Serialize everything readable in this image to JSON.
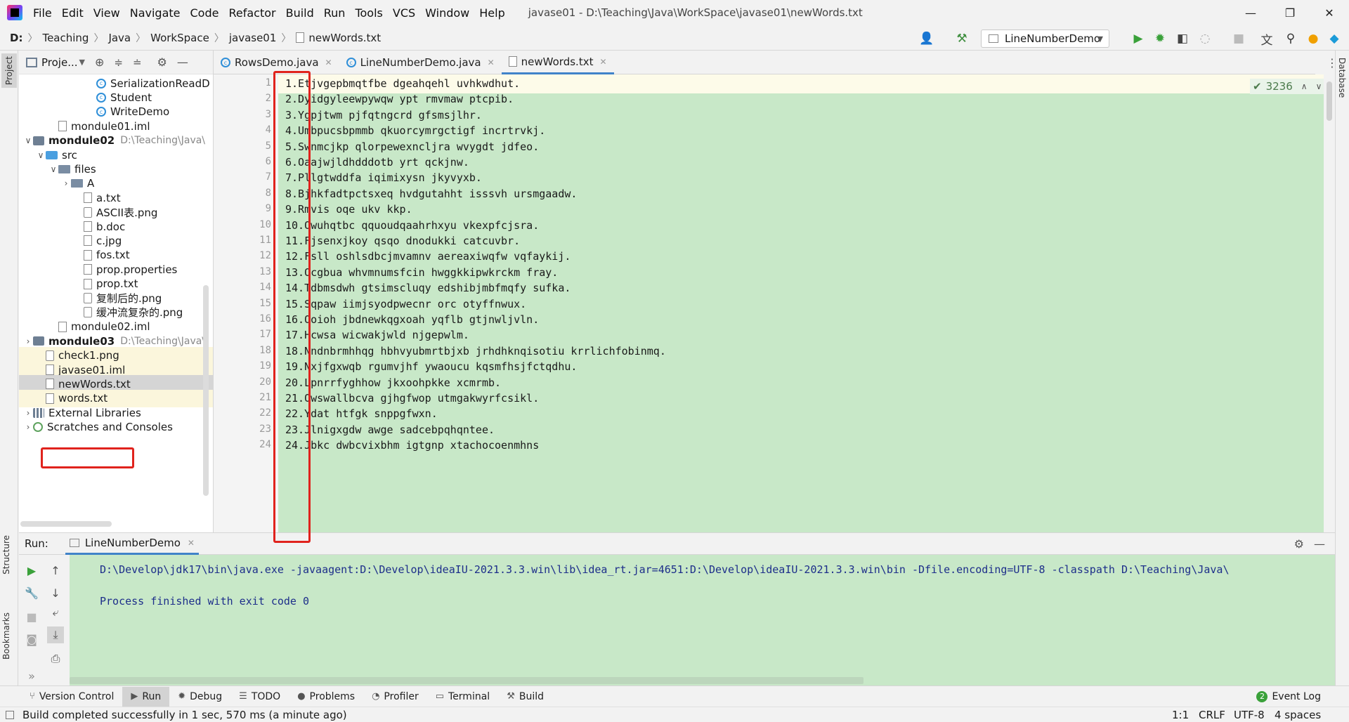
{
  "window": {
    "title": "javase01 - D:\\Teaching\\Java\\WorkSpace\\javase01\\newWords.txt",
    "minimize": "—",
    "maximize": "❐",
    "close": "✕"
  },
  "menu": [
    "File",
    "Edit",
    "View",
    "Navigate",
    "Code",
    "Refactor",
    "Build",
    "Run",
    "Tools",
    "VCS",
    "Window",
    "Help"
  ],
  "breadcrumb": [
    "D:",
    "Teaching",
    "Java",
    "WorkSpace",
    "javase01",
    "newWords.txt"
  ],
  "toolbar": {
    "run_config": "LineNumberDemo"
  },
  "left_strip": {
    "project": "Project",
    "structure": "Structure",
    "bookmarks": "Bookmarks"
  },
  "right_strip": {
    "database": "Database"
  },
  "project_panel": {
    "title": "Proje...",
    "items": [
      {
        "label": "SerializationReadD",
        "icon": "java-class-icon",
        "indent": 5,
        "arrow": ""
      },
      {
        "label": "Student",
        "icon": "java-class-icon",
        "indent": 5,
        "arrow": ""
      },
      {
        "label": "WriteDemo",
        "icon": "java-class-icon",
        "indent": 5,
        "arrow": ""
      },
      {
        "label": "mondule01.iml",
        "icon": "iml-file-icon",
        "indent": 2,
        "arrow": ""
      },
      {
        "label": "mondule02",
        "icon": "module-icon",
        "indent": 0,
        "arrow": "∨",
        "bold": true,
        "hint": "D:\\Teaching\\Java\\"
      },
      {
        "label": "src",
        "icon": "source-folder-icon",
        "indent": 1,
        "arrow": "∨"
      },
      {
        "label": "files",
        "icon": "folder-icon",
        "indent": 2,
        "arrow": "∨"
      },
      {
        "label": "A",
        "icon": "folder-icon",
        "indent": 3,
        "arrow": "›"
      },
      {
        "label": "a.txt",
        "icon": "text-file-icon",
        "indent": 4,
        "arrow": ""
      },
      {
        "label": "ASCII表.png",
        "icon": "image-file-icon",
        "indent": 4,
        "arrow": ""
      },
      {
        "label": "b.doc",
        "icon": "unknown-file-icon",
        "indent": 4,
        "arrow": ""
      },
      {
        "label": "c.jpg",
        "icon": "unknown-file-icon",
        "indent": 4,
        "arrow": ""
      },
      {
        "label": "fos.txt",
        "icon": "text-file-icon",
        "indent": 4,
        "arrow": ""
      },
      {
        "label": "prop.properties",
        "icon": "properties-file-icon",
        "indent": 4,
        "arrow": ""
      },
      {
        "label": "prop.txt",
        "icon": "text-file-icon",
        "indent": 4,
        "arrow": ""
      },
      {
        "label": "复制后的.png",
        "icon": "image-file-icon",
        "indent": 4,
        "arrow": ""
      },
      {
        "label": "缓冲流复杂的.png",
        "icon": "image-file-icon",
        "indent": 4,
        "arrow": ""
      },
      {
        "label": "mondule02.iml",
        "icon": "iml-file-icon",
        "indent": 2,
        "arrow": ""
      },
      {
        "label": "mondule03",
        "icon": "module-icon",
        "indent": 0,
        "arrow": "›",
        "bold": true,
        "hint": "D:\\Teaching\\Java\\"
      },
      {
        "label": "check1.png",
        "icon": "image-file-icon",
        "indent": 1,
        "arrow": "",
        "hl": true
      },
      {
        "label": "javase01.iml",
        "icon": "iml-file-icon",
        "indent": 1,
        "arrow": "",
        "hl": true
      },
      {
        "label": "newWords.txt",
        "icon": "text-file-icon",
        "indent": 1,
        "arrow": "",
        "selected": true
      },
      {
        "label": "words.txt",
        "icon": "text-file-icon",
        "indent": 1,
        "arrow": "",
        "hl": true
      },
      {
        "label": "External Libraries",
        "icon": "library-icon",
        "indent": 0,
        "arrow": "›"
      },
      {
        "label": "Scratches and Consoles",
        "icon": "scratches-icon",
        "indent": 0,
        "arrow": "›"
      }
    ]
  },
  "editor": {
    "tabs": [
      {
        "label": "RowsDemo.java",
        "icon": "java-class-icon"
      },
      {
        "label": "LineNumberDemo.java",
        "icon": "java-class-icon"
      },
      {
        "label": "newWords.txt",
        "icon": "text-file-icon",
        "active": true
      }
    ],
    "inspection_count": "3236",
    "lines": [
      "1.Etjvgepbmqtfbe dgeahqehl uvhkwdhut.",
      "2.Dyidgyleewpywqw ypt rmvmaw ptcpib.",
      "3.Ygpjtwm pjfqtngcrd gfsmsjlhr.",
      "4.Umbpucsbpmmb qkuorcymrgctigf incrtrvkj.",
      "5.Swnmcjkp qlorpewexncljra wvygdt jdfeo.",
      "6.Oaajwjldhdddotb yrt qckjnw.",
      "7.Pllgtwddfa iqimixysn jkyvyxb.",
      "8.Bjhkfadtpctsxeq hvdgutahht isssvh ursmgaadw.",
      "9.Rmvis oqe ukv kkp.",
      "10.Owuhqtbc qquoudqaahrhxyu vkexpfcjsra.",
      "11.Fjsenxjkoy qsqo dnodukki catcuvbr.",
      "12.Fsll oshlsdbcjmvamnv aereaxiwqfw vqfaykij.",
      "13.Ocgbua whvmnumsfcin hwggkkipwkrckm fray.",
      "14.Tdbmsdwh gtsimscluqy edshibjmbfmqfy sufka.",
      "15.Sqpaw iimjsyodpwecnr orc otyffnwux.",
      "16.Ooioh jbdnewkqgxoah yqflb gtjnwljvln.",
      "17.Hcwsa wicwakjwld njgepwlm.",
      "18.Nndnbrmhhqg hbhvyubmrtbjxb jrhdhknqisotiu krrlichfobinmq.",
      "19.Nxjfgxwqb rgumvjhf ywaoucu kqsmfhsjfctqdhu.",
      "20.Lpnrrfyghhow jkxoohpkke xcmrmb.",
      "21.Owswallbcva gjhgfwop utmgakwyrfcsikl.",
      "22.Ydat htfgk snppgfwxn.",
      "23.Jlnigxgdw awge sadcebpqhqntee.",
      "24.Jbkc dwbcvixbhm igtgnp xtachocoenmhns"
    ]
  },
  "run_panel": {
    "label": "Run:",
    "tab": "LineNumberDemo",
    "console": [
      "D:\\Develop\\jdk17\\bin\\java.exe -javaagent:D:\\Develop\\ideaIU-2021.3.3.win\\lib\\idea_rt.jar=4651:D:\\Develop\\ideaIU-2021.3.3.win\\bin -Dfile.encoding=UTF-8 -classpath D:\\Teaching\\Java\\",
      "",
      "Process finished with exit code 0"
    ]
  },
  "bottom_tabs": [
    {
      "label": "Version Control",
      "icon": "version-control-icon"
    },
    {
      "label": "Run",
      "icon": "run-icon",
      "active": true
    },
    {
      "label": "Debug",
      "icon": "debug-icon"
    },
    {
      "label": "TODO",
      "icon": "todo-icon"
    },
    {
      "label": "Problems",
      "icon": "problems-icon"
    },
    {
      "label": "Profiler",
      "icon": "profiler-icon"
    },
    {
      "label": "Terminal",
      "icon": "terminal-icon"
    },
    {
      "label": "Build",
      "icon": "build-icon"
    }
  ],
  "event_log": {
    "label": "Event Log",
    "count": "2"
  },
  "status": {
    "message": "Build completed successfully in 1 sec, 570 ms (a minute ago)",
    "position": "1:1",
    "line_sep": "CRLF",
    "encoding": "UTF-8",
    "indent": "4 spaces"
  },
  "colors": {
    "editor_bg": "#c8e8c8",
    "highlight_red": "#e0231d",
    "console_text": "#1d2e8a",
    "accent_blue": "#4083c9"
  }
}
